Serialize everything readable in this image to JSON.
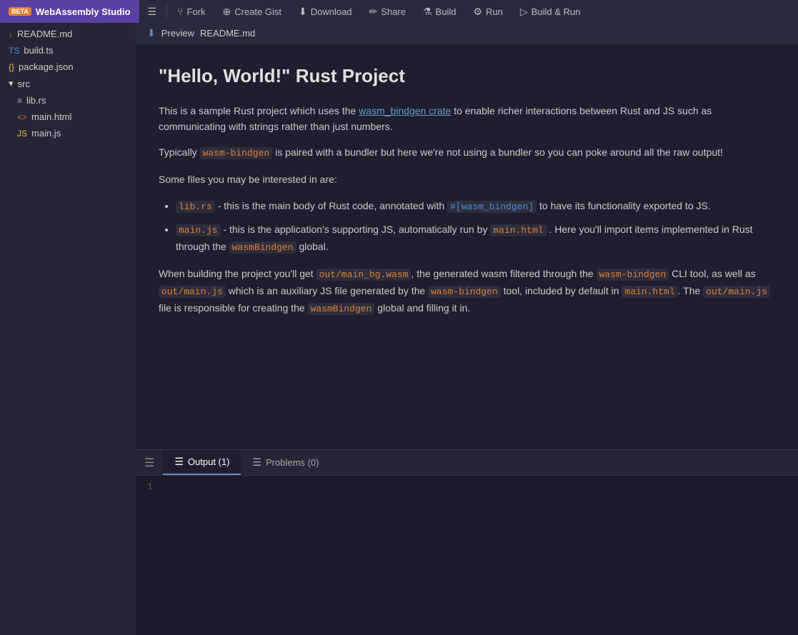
{
  "app": {
    "title": "WebAssembly Studio",
    "beta": "BETA"
  },
  "toolbar": {
    "menu_icon": "☰",
    "fork_label": "Fork",
    "fork_icon": "⑂",
    "gist_label": "Create Gist",
    "gist_icon": "⊕",
    "download_label": "Download",
    "download_icon": "⬇",
    "share_label": "Share",
    "share_icon": "✏",
    "build_label": "Build",
    "build_icon": "⚗",
    "run_label": "Run",
    "run_icon": "⚙",
    "buildrun_label": "Build & Run",
    "buildrun_icon": "▷"
  },
  "sidebar": {
    "files": [
      {
        "name": "README.md",
        "type": "md",
        "prefix": "↓"
      },
      {
        "name": "build.ts",
        "type": "ts",
        "prefix": "TS"
      },
      {
        "name": "package.json",
        "type": "json",
        "prefix": "{}"
      }
    ],
    "folder": {
      "name": "src",
      "prefix": "▾",
      "children": [
        {
          "name": "lib.rs",
          "type": "rs",
          "prefix": "≡"
        },
        {
          "name": "main.html",
          "type": "html",
          "prefix": "<>"
        },
        {
          "name": "main.js",
          "type": "js",
          "prefix": "JS"
        }
      ]
    }
  },
  "preview": {
    "icon": "⬇",
    "filename": "README.md"
  },
  "markdown": {
    "title": "\"Hello, World!\" Rust Project",
    "p1_before": "This is a sample Rust project which uses the ",
    "p1_link": "wasm_bindgen crate",
    "p1_after": " to enable richer interactions between Rust and JS such as communicating with strings rather than just numbers.",
    "p2_before": "Typically ",
    "p2_code": "wasm-bindgen",
    "p2_after": " is paired with a bundler but here we're not using a bundler so you can poke around all the raw output!",
    "p3": "Some files you may be interested in are:",
    "bullets": [
      {
        "code1": "lib.rs",
        "text1": " - this is the main body of Rust code, annotated with ",
        "code2": "#[wasm_bindgen]",
        "text2": " to have its functionality exported to JS."
      },
      {
        "code1": "main.js",
        "text1": " - this is the application's supporting JS, automatically run by ",
        "code2": "main.html",
        "text2": ". Here you'll import items implemented in Rust through the ",
        "code3": "wasmBindgen",
        "text3": " global."
      }
    ],
    "p4_before": "When building the project you'll get ",
    "p4_code1": "out/main_bg.wasm",
    "p4_mid1": ", the generated wasm filtered through the ",
    "p4_code2": "wasm-bindgen",
    "p4_mid2": " CLI tool, as well as ",
    "p4_code3": "out/main.js",
    "p4_mid3": " which is an auxiliary JS file generated by the ",
    "p4_code4": "wasm-bindgen",
    "p4_mid4": " tool, included by default in ",
    "p4_code5": "main.html",
    "p4_mid5": ". The ",
    "p4_code6": "out/main.js",
    "p4_mid6": " file is responsible for creating the ",
    "p4_code7": "wasmBindgen",
    "p4_end": " global and filling it in."
  },
  "bottom": {
    "tabs": [
      {
        "label": "Output (1)",
        "active": true
      },
      {
        "label": "Problems (0)",
        "active": false
      }
    ],
    "line_number": "1",
    "content": ""
  }
}
